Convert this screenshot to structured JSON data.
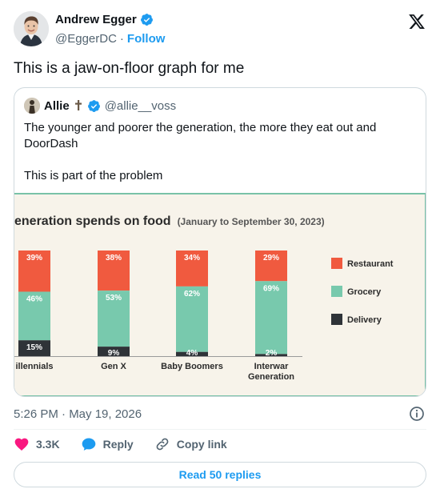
{
  "author": {
    "name": "Andrew Egger",
    "handle": "@EggerDC",
    "separator": "·",
    "follow_label": "Follow"
  },
  "tweet": {
    "text": "This is a jaw-on-floor graph for me",
    "timestamp": "5:26 PM · May 19, 2026"
  },
  "quoted": {
    "name": "Allie",
    "handle": "@allie__voss",
    "paragraph1": "The younger and poorer the generation, the more they eat out and DoorDash",
    "paragraph2": "This is part of the problem"
  },
  "actions": {
    "likes": "3.3K",
    "reply_label": "Reply",
    "copy_label": "Copy link",
    "read_replies_label": "Read 50 replies"
  },
  "colors": {
    "restaurant": "#f05a3f",
    "grocery": "#78c9ad",
    "delivery": "#2f3338",
    "accent": "#1d9bf0",
    "like": "#f91880"
  },
  "chart_data": {
    "type": "bar",
    "stacked": true,
    "title": "eneration spends on food",
    "subtitle": "(January to September 30, 2023)",
    "categories": [
      "illennials",
      "Gen X",
      "Baby Boomers",
      "Interwar Generation"
    ],
    "category_lines": [
      [
        "illennials"
      ],
      [
        "Gen X"
      ],
      [
        "Baby Boomers"
      ],
      [
        "Interwar",
        "Generation"
      ]
    ],
    "series": [
      {
        "name": "Restaurant",
        "values": [
          39,
          38,
          34,
          29
        ],
        "labels": [
          "39%",
          "38%",
          "34%",
          "29%"
        ]
      },
      {
        "name": "Grocery",
        "values": [
          46,
          53,
          62,
          69
        ],
        "labels": [
          "46%",
          "53%",
          "62%",
          "69%"
        ]
      },
      {
        "name": "Delivery",
        "values": [
          15,
          9,
          4,
          2
        ],
        "labels": [
          "15%",
          "9%",
          "4%",
          "2%"
        ]
      }
    ],
    "ylim": [
      0,
      100
    ],
    "legend_position": "right"
  }
}
